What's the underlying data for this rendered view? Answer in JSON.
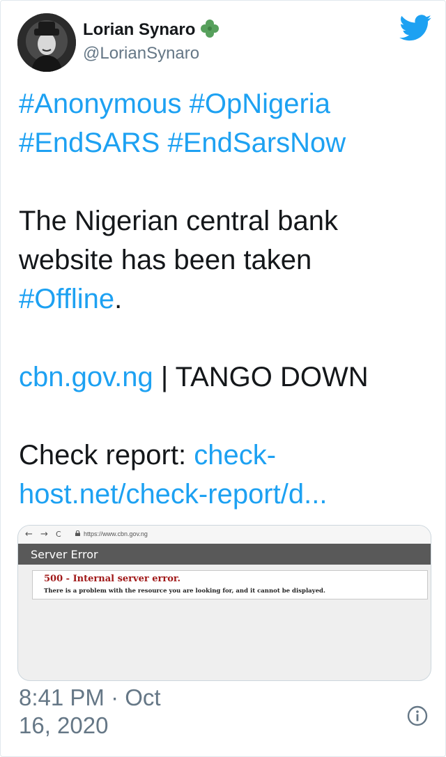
{
  "tweet": {
    "author": {
      "name": "Lorian Synaro",
      "handle": "@LorianSynaro",
      "badge_icon": "shamrock-icon"
    },
    "logo_icon": "twitter-bird-icon",
    "hashtags_line1": [
      "#Anonymous",
      "#OpNigeria"
    ],
    "hashtags_line2": [
      "#EndSARS",
      "#EndSarsNow"
    ],
    "body_line1": "The Nigerian central bank",
    "body_line2": "website has been taken",
    "body_hashtag": "#Offline",
    "body_period": ".",
    "site_link": "cbn.gov.ng",
    "site_rest": " | TANGO DOWN",
    "report_label": "Check report: ",
    "report_link_part1": "check-",
    "report_link_part2": "host.net/check-report/d...",
    "timestamp_line1": "8:41 PM · Oct",
    "timestamp_line2": "16, 2020",
    "info_icon": "info-icon"
  },
  "media": {
    "browser": {
      "url": "https://www.cbn.gov.ng",
      "back": "←",
      "forward": "→",
      "reload": "C"
    },
    "error_title": "Server Error",
    "error_code": "500 - Internal server error.",
    "error_message": "There is a problem with the resource you are looking for, and it cannot be displayed."
  },
  "colors": {
    "link": "#1da1f2",
    "muted": "#657786",
    "error_red": "#a01818",
    "error_bar": "#595959"
  }
}
